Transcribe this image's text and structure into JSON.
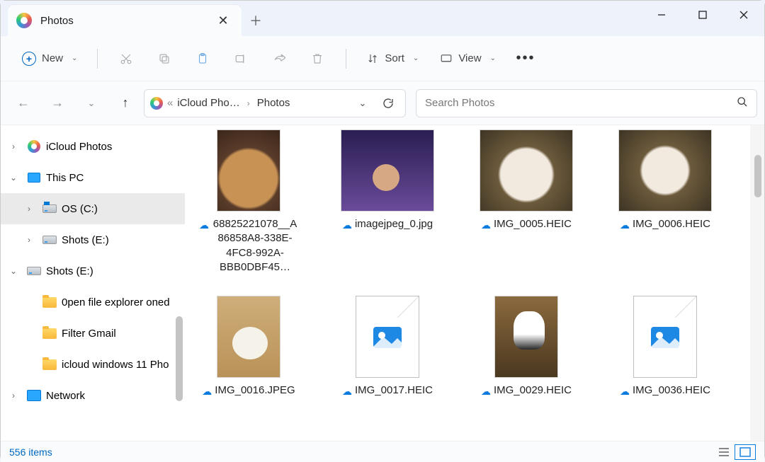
{
  "tab": {
    "title": "Photos"
  },
  "toolbar": {
    "new": "New",
    "sort": "Sort",
    "view": "View"
  },
  "breadcrumb": {
    "parent": "iCloud Pho…",
    "current": "Photos"
  },
  "search": {
    "placeholder": "Search Photos"
  },
  "sidebar": {
    "items": [
      {
        "label": "iCloud Photos",
        "icon": "photos",
        "chev": "right",
        "indent": 0,
        "sel": false
      },
      {
        "label": "This PC",
        "icon": "monitor",
        "chev": "down",
        "indent": 0,
        "sel": false
      },
      {
        "label": "OS (C:)",
        "icon": "drive-os",
        "chev": "right",
        "indent": 1,
        "sel": true
      },
      {
        "label": "Shots (E:)",
        "icon": "drive",
        "chev": "right",
        "indent": 1,
        "sel": false
      },
      {
        "label": "Shots (E:)",
        "icon": "drive",
        "chev": "down",
        "indent": 0,
        "sel": false
      },
      {
        "label": "0pen file explorer oned",
        "icon": "folder",
        "chev": "",
        "indent": 1,
        "sel": false
      },
      {
        "label": "Filter Gmail",
        "icon": "folder",
        "chev": "",
        "indent": 1,
        "sel": false
      },
      {
        "label": "icloud windows 11 Pho",
        "icon": "folder",
        "chev": "",
        "indent": 1,
        "sel": false
      },
      {
        "label": "Network",
        "icon": "net",
        "chev": "right",
        "indent": 0,
        "sel": false
      }
    ]
  },
  "files": {
    "items": [
      {
        "name": "68825221078__A86858A8-338E-4FC8-992A-BBB0DBF45…",
        "thumb": "cookies",
        "w": "narrow"
      },
      {
        "name": "imagejpeg_0.jpg",
        "thumb": "selfie",
        "w": "wide"
      },
      {
        "name": "IMG_0005.HEIC",
        "thumb": "dog",
        "w": "wide"
      },
      {
        "name": "IMG_0006.HEIC",
        "thumb": "dog2",
        "w": "wide"
      },
      {
        "name": "IMG_0016.JPEG",
        "thumb": "puppy",
        "w": "narrow"
      },
      {
        "name": "IMG_0017.HEIC",
        "thumb": "file",
        "w": "narrow"
      },
      {
        "name": "IMG_0029.HEIC",
        "thumb": "cat",
        "w": "narrow"
      },
      {
        "name": "IMG_0036.HEIC",
        "thumb": "file",
        "w": "narrow"
      }
    ]
  },
  "status": {
    "text": "556 items"
  }
}
